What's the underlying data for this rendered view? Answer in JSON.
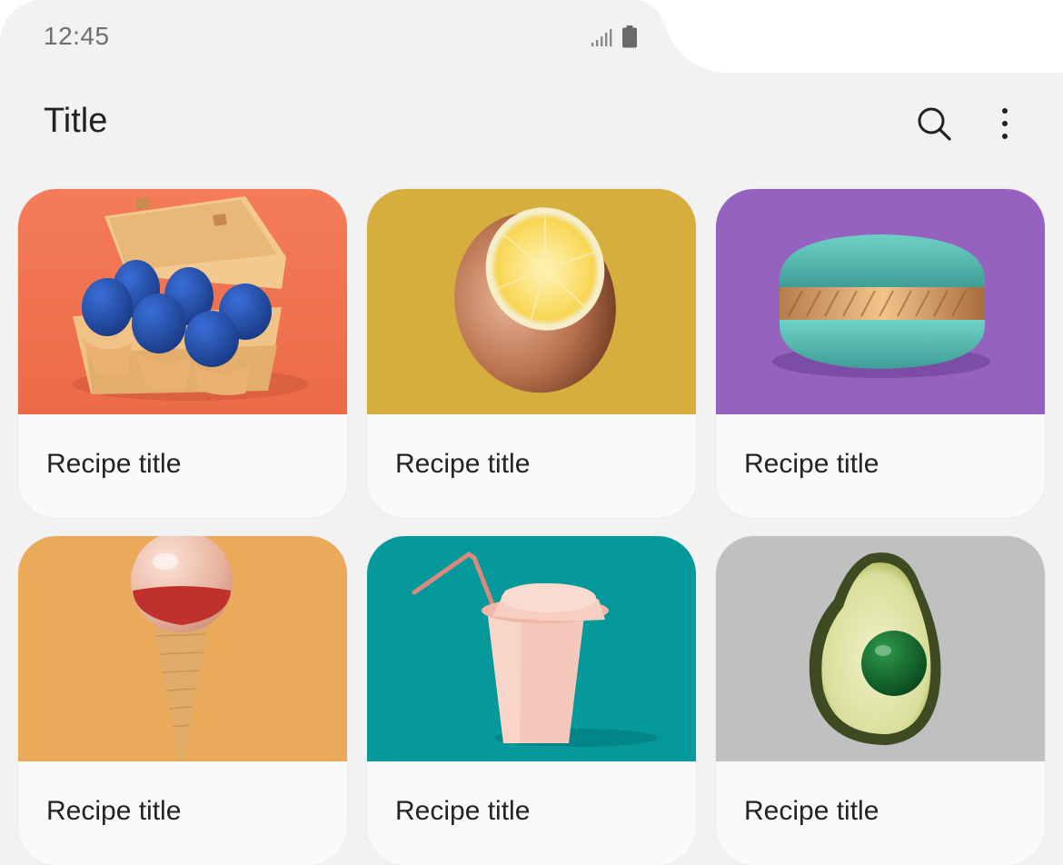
{
  "status_bar": {
    "time": "12:45",
    "signal_icon": "signal-icon",
    "battery_icon": "battery-icon"
  },
  "app_bar": {
    "title": "Title",
    "search_icon": "search-icon",
    "more_icon": "more-vert-icon"
  },
  "colors": {
    "background": "#f2f2f2",
    "card": "#fafafa",
    "text": "#222222"
  },
  "recipes": [
    {
      "title": "Recipe title",
      "image": "blue eggs in carton",
      "bg": "#f27452"
    },
    {
      "title": "Recipe title",
      "image": "bronze lemon half",
      "bg": "#d6ae3e"
    },
    {
      "title": "Recipe title",
      "image": "teal macaron",
      "bg": "#9662c0"
    },
    {
      "title": "Recipe title",
      "image": "glitter ball ice cream cone",
      "bg": "#eba95a"
    },
    {
      "title": "Recipe title",
      "image": "pink paper cup with straw",
      "bg": "#05999c"
    },
    {
      "title": "Recipe title",
      "image": "avocado with green ball",
      "bg": "#c0c0c0"
    }
  ]
}
